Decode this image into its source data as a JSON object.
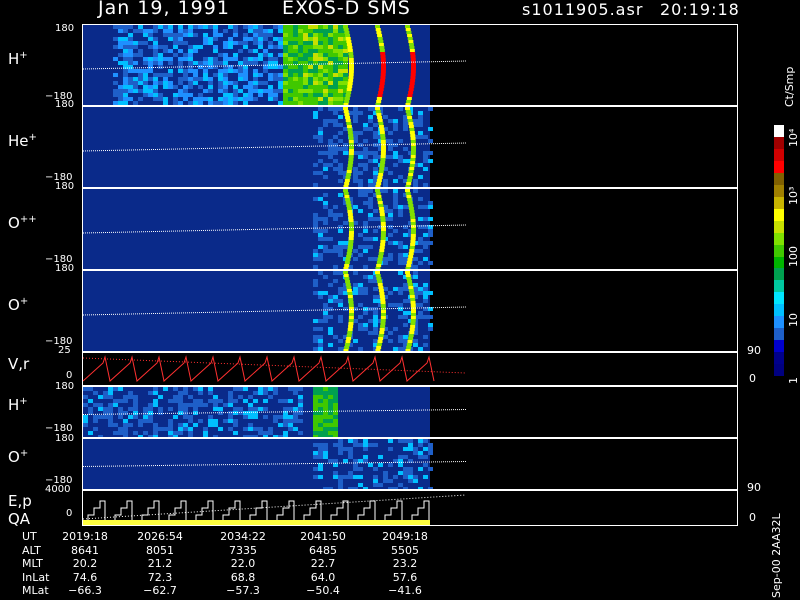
{
  "header": {
    "date": "Jan 19, 1991",
    "instrument": "EXOS-D SMS",
    "filename": "s1011905.asr",
    "time": "20:19:18"
  },
  "panels": [
    {
      "species": "H",
      "charge": "+",
      "ymax": "180",
      "ymin": "−180"
    },
    {
      "species": "He",
      "charge": "+",
      "ymax": "180",
      "ymin": "−180"
    },
    {
      "species": "O",
      "charge": "++",
      "ymax": "180",
      "ymin": "−180"
    },
    {
      "species": "O",
      "charge": "+",
      "ymax": "180",
      "ymin": "−180"
    }
  ],
  "velocity_panel": {
    "label": "V,r",
    "ymax": "25",
    "ymin": "0",
    "rmax": "90",
    "rmin": "0"
  },
  "small_panels": [
    {
      "species": "H",
      "charge": "+",
      "ymax": "180",
      "ymin": "−180"
    },
    {
      "species": "O",
      "charge": "+",
      "ymax": "180",
      "ymin": "−180"
    }
  ],
  "energy_panel": {
    "label": "E,p",
    "ymax": "4000",
    "ymin": "0",
    "rmax": "90",
    "rmin": "0"
  },
  "qa_label": "QA",
  "colorbar": {
    "units": "Ct/Smp",
    "labels": [
      "10⁴",
      "10³",
      "100",
      "10",
      "1"
    ],
    "colors": [
      "#000080",
      "#00008b",
      "#0000cd",
      "#1e5fc8",
      "#1e90ff",
      "#00bfff",
      "#00e5ff",
      "#00c8a0",
      "#00a050",
      "#00b400",
      "#40c800",
      "#80e000",
      "#c8e000",
      "#ffff00",
      "#c8b400",
      "#a08000",
      "#806000",
      "#ff0000",
      "#d00000",
      "#a00000",
      "#ffffff"
    ]
  },
  "orbit_table": {
    "rows": [
      {
        "name": "UT",
        "values": [
          "2019:18",
          "2026:54",
          "2034:22",
          "2041:50",
          "2049:18"
        ]
      },
      {
        "name": "ALT",
        "values": [
          "8641",
          "8051",
          "7335",
          "6485",
          "5505"
        ]
      },
      {
        "name": "MLT",
        "values": [
          "20.2",
          "21.2",
          "22.0",
          "22.7",
          "23.2"
        ]
      },
      {
        "name": "InLat",
        "values": [
          "74.6",
          "72.3",
          "68.8",
          "64.0",
          "57.6"
        ]
      },
      {
        "name": "MLat",
        "values": [
          "−66.3",
          "−62.7",
          "−57.3",
          "−50.4",
          "−41.6"
        ]
      }
    ]
  },
  "footer_code": "Sep-00 2AA32L",
  "chart_data": {
    "type": "heatmap",
    "title": "Jan 19, 1991 EXOS-D SMS",
    "x_ticks_ut": [
      "2019:18",
      "2026:54",
      "2034:22",
      "2041:50",
      "2049:18"
    ],
    "y_range_deg": [
      -180,
      180
    ],
    "colorbar_range": [
      1,
      10000
    ],
    "colorbar_scale": "log",
    "series": [
      {
        "name": "H+",
        "coverage_end_fraction": 0.53
      },
      {
        "name": "He+",
        "coverage_end_fraction": 0.53
      },
      {
        "name": "O++",
        "coverage_end_fraction": 0.53
      },
      {
        "name": "O+",
        "coverage_end_fraction": 0.53
      }
    ]
  }
}
